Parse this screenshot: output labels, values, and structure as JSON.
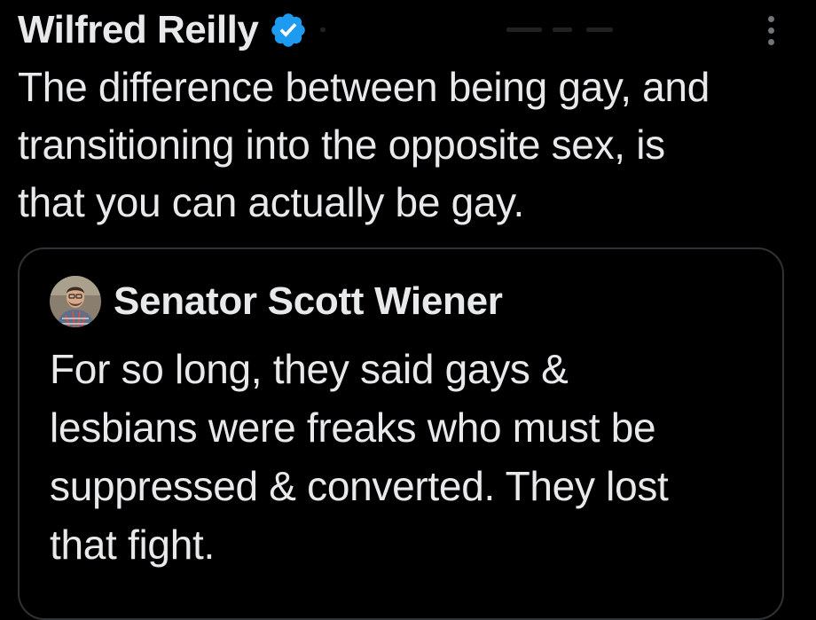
{
  "tweet": {
    "author_name": "Wilfred Reilly",
    "text": "The difference between being gay, and\ntransitioning into the opposite sex, is\nthat you can actually be gay.",
    "verified_icon": "verified-badge-icon",
    "more_icon": "more-options-icon"
  },
  "quoted_tweet": {
    "author_name": "Senator Scott Wiener",
    "text": "For so long, they said gays &\nlesbians were freaks who must be\nsuppressed & converted. They lost\nthat fight."
  },
  "colors": {
    "background": "#000000",
    "text": "#e7e9ea",
    "verified": "#1d9bf0",
    "border": "#2f3336",
    "muted": "#71767b"
  }
}
